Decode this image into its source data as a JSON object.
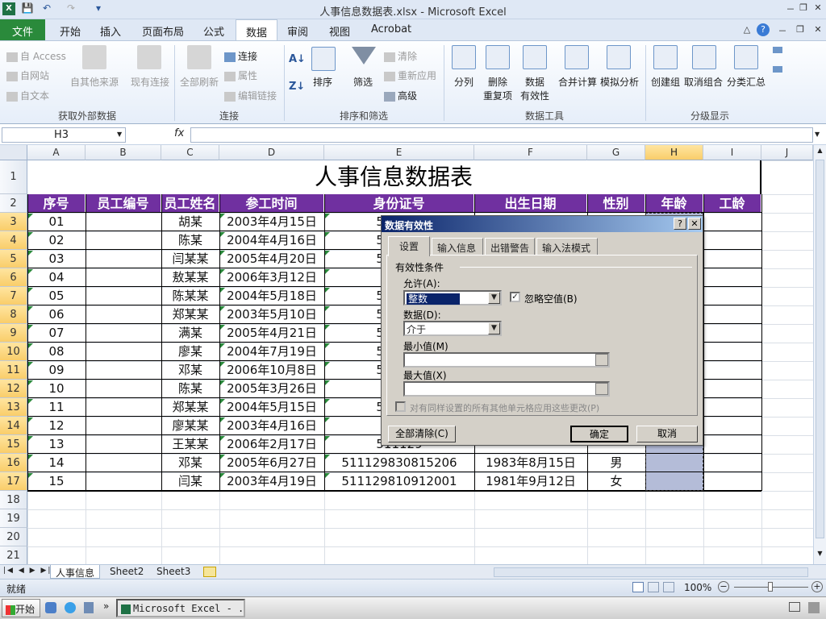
{
  "window": {
    "title": "人事信息数据表.xlsx - Microsoft Excel",
    "controls": [
      "－",
      "❐",
      "✕"
    ],
    "doc_controls": [
      "△",
      "?",
      "－",
      "❐",
      "✕"
    ]
  },
  "quick_access": [
    "💾",
    "↶",
    "↷",
    "▾"
  ],
  "tabs": [
    "文件",
    "开始",
    "插入",
    "页面布局",
    "公式",
    "数据",
    "审阅",
    "视图",
    "Acrobat"
  ],
  "active_tab": "数据",
  "ribbon": {
    "ext_data": {
      "access": "自 Access",
      "web": "自网站",
      "text": "自文本",
      "other": "自其他来源",
      "existing": "现有连接",
      "label": "获取外部数据"
    },
    "connections": {
      "refresh": "全部刷新",
      "conn": "连接",
      "props": "属性",
      "edit_links": "编辑链接",
      "label": "连接"
    },
    "sort_filter": {
      "sort": "排序",
      "filter": "筛选",
      "clear": "清除",
      "reapply": "重新应用",
      "advanced": "高级",
      "label": "排序和筛选"
    },
    "data_tools": {
      "split": "分列",
      "remove_dup_1": "删除",
      "remove_dup_2": "重复项",
      "validation_1": "数据",
      "validation_2": "有效性",
      "consolidate": "合并计算",
      "whatif": "模拟分析",
      "label": "数据工具"
    },
    "outline": {
      "group": "创建组",
      "ungroup": "取消组合",
      "subtotal": "分类汇总",
      "label": "分级显示"
    }
  },
  "formula_bar": {
    "name_box": "H3",
    "fx": "fx",
    "value": ""
  },
  "columns": [
    "A",
    "B",
    "C",
    "D",
    "E",
    "F",
    "G",
    "H",
    "I",
    "J"
  ],
  "rows": [
    "1",
    "2",
    "3",
    "4",
    "5",
    "6",
    "7",
    "8",
    "9",
    "10",
    "11",
    "12",
    "13",
    "14",
    "15",
    "16",
    "17",
    "18",
    "19",
    "20",
    "21",
    "22"
  ],
  "sheet": {
    "title": "人事信息数据表",
    "headers": [
      "序号",
      "员工编号",
      "员工姓名",
      "参工时间",
      "身份证号",
      "出生日期",
      "性别",
      "年龄",
      "工龄"
    ],
    "records": [
      [
        "01",
        "",
        "胡某",
        "2003年4月15日",
        "511129",
        "",
        "",
        "",
        ""
      ],
      [
        "02",
        "",
        "陈某",
        "2004年4月16日",
        "511129",
        "",
        "",
        "",
        ""
      ],
      [
        "03",
        "",
        "闫某某",
        "2005年4月20日",
        "511129",
        "",
        "",
        "",
        ""
      ],
      [
        "04",
        "",
        "敖某某",
        "2006年3月12日",
        "5112",
        "",
        "",
        "",
        ""
      ],
      [
        "05",
        "",
        "陈某某",
        "2004年5月18日",
        "511129",
        "",
        "",
        "",
        ""
      ],
      [
        "06",
        "",
        "郑某某",
        "2003年5月10日",
        "511129",
        "",
        "",
        "",
        ""
      ],
      [
        "07",
        "",
        "满某",
        "2005年4月21日",
        "511129",
        "",
        "",
        "",
        ""
      ],
      [
        "08",
        "",
        "廖某",
        "2004年7月19日",
        "511129",
        "",
        "",
        "",
        ""
      ],
      [
        "09",
        "",
        "邓某",
        "2006年10月8日",
        "511129",
        "",
        "",
        "",
        ""
      ],
      [
        "10",
        "",
        "陈某",
        "2005年3月26日",
        "5112",
        "",
        "",
        "",
        ""
      ],
      [
        "11",
        "",
        "郑某某",
        "2004年5月15日",
        "511129",
        "",
        "",
        "",
        ""
      ],
      [
        "12",
        "",
        "廖某某",
        "2003年4月16日",
        "5112",
        "",
        "",
        "",
        ""
      ],
      [
        "13",
        "",
        "王某某",
        "2006年2月17日",
        "511129",
        "",
        "",
        "",
        ""
      ],
      [
        "14",
        "",
        "邓某",
        "2005年6月27日",
        "511129830815206",
        "1983年8月15日",
        "男",
        "",
        ""
      ],
      [
        "15",
        "",
        "闫某",
        "2003年4月19日",
        "511129810912001",
        "1981年9月12日",
        "女",
        "",
        ""
      ]
    ]
  },
  "sheet_tabs": [
    "人事信息",
    "Sheet2",
    "Sheet3"
  ],
  "sheet_nav": [
    "|◀",
    "◀",
    "▶",
    "▶|"
  ],
  "status": {
    "ready": "就绪",
    "zoom": "100%"
  },
  "taskbar": {
    "start": "开始",
    "task": "Microsoft Excel - ...",
    "more": "»"
  },
  "dialog": {
    "title": "数据有效性",
    "help": "?",
    "close": "✕",
    "tabs": [
      "设置",
      "输入信息",
      "出错警告",
      "输入法模式"
    ],
    "section": "有效性条件",
    "allow_label": "允许(A):",
    "allow_value": "整数",
    "ignore_blank": "忽略空值(B)",
    "ignore_blank_check": "✓",
    "data_label": "数据(D):",
    "data_value": "介于",
    "min_label": "最小值(M)",
    "max_label": "最大值(X)",
    "apply_all": "对有同样设置的所有其他单元格应用这些更改(P)",
    "clear_all": "全部清除(C)",
    "ok": "确定",
    "cancel": "取消"
  },
  "colors": {
    "header_bg": "#7030a0",
    "selection": "#b4bcd8",
    "file_tab": "#2a8a3b"
  }
}
